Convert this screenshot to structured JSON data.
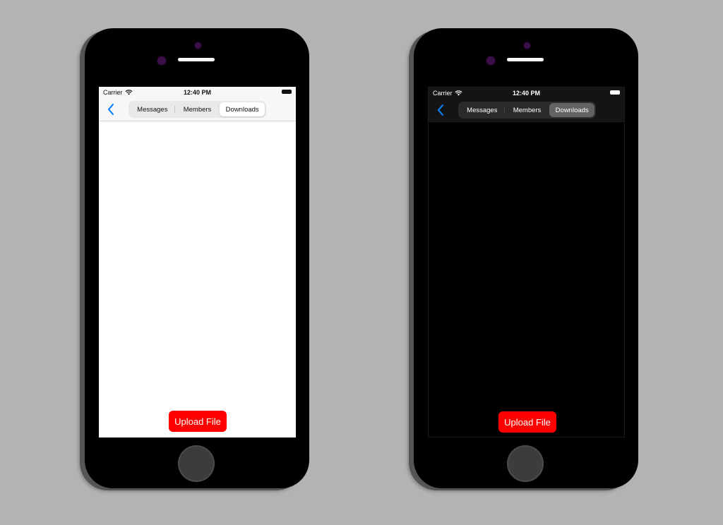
{
  "phones": [
    {
      "theme": "light",
      "status_bar": {
        "carrier": "Carrier",
        "time": "12:40 PM"
      },
      "nav": {
        "back_icon": "chevron-left-icon",
        "segments": [
          {
            "label": "Messages",
            "selected": false
          },
          {
            "label": "Members",
            "selected": false
          },
          {
            "label": "Downloads",
            "selected": true
          }
        ]
      },
      "upload_button": {
        "label": "Upload File"
      }
    },
    {
      "theme": "dark",
      "status_bar": {
        "carrier": "Carrier",
        "time": "12:40 PM"
      },
      "nav": {
        "back_icon": "chevron-left-icon",
        "segments": [
          {
            "label": "Messages",
            "selected": false
          },
          {
            "label": "Members",
            "selected": false
          },
          {
            "label": "Downloads",
            "selected": true
          }
        ]
      },
      "upload_button": {
        "label": "Upload File"
      }
    }
  ],
  "colors": {
    "accent": "#007aff",
    "upload_button_bg": "#ff0000",
    "background": "#b3b3b3"
  }
}
